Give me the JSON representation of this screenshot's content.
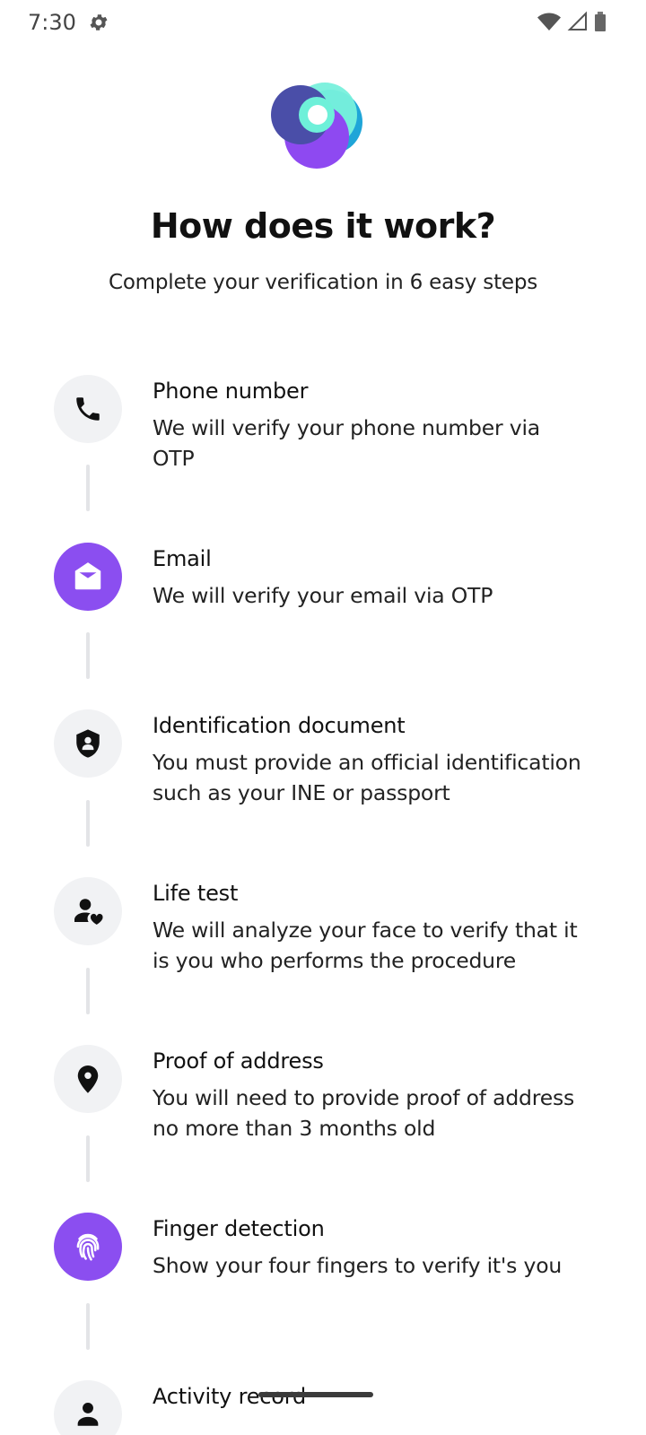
{
  "status": {
    "time": "7:30",
    "icons": [
      "gear-icon",
      "wifi-icon",
      "signal-icon",
      "battery-icon"
    ]
  },
  "header": {
    "title": "How does it work?",
    "subtitle": "Complete your verification in 6 easy steps"
  },
  "colors": {
    "accent": "#8b4ef0",
    "icon_bg": "#f1f2f4",
    "connector": "#e3e4e7"
  },
  "steps": [
    {
      "title": "Phone number",
      "description": "We will verify your phone number via OTP",
      "icon": "phone-icon"
    },
    {
      "title": "Email",
      "description": "We will verify your email via OTP",
      "icon": "email-icon"
    },
    {
      "title": "Identification document",
      "description": "You must provide an official identification such as your INE or passport",
      "icon": "id-shield-icon"
    },
    {
      "title": "Life test",
      "description": "We will analyze your face to verify that it is you who performs the procedure",
      "icon": "person-heart-icon"
    },
    {
      "title": "Proof of address",
      "description": "You will need to provide proof of address no more than 3 months old",
      "icon": "location-pin-icon"
    },
    {
      "title": "Finger detection",
      "description": "Show your four fingers to verify it's you",
      "icon": "fingerprint-icon"
    },
    {
      "title": "Activity record",
      "description": "",
      "icon": "person-icon"
    }
  ]
}
